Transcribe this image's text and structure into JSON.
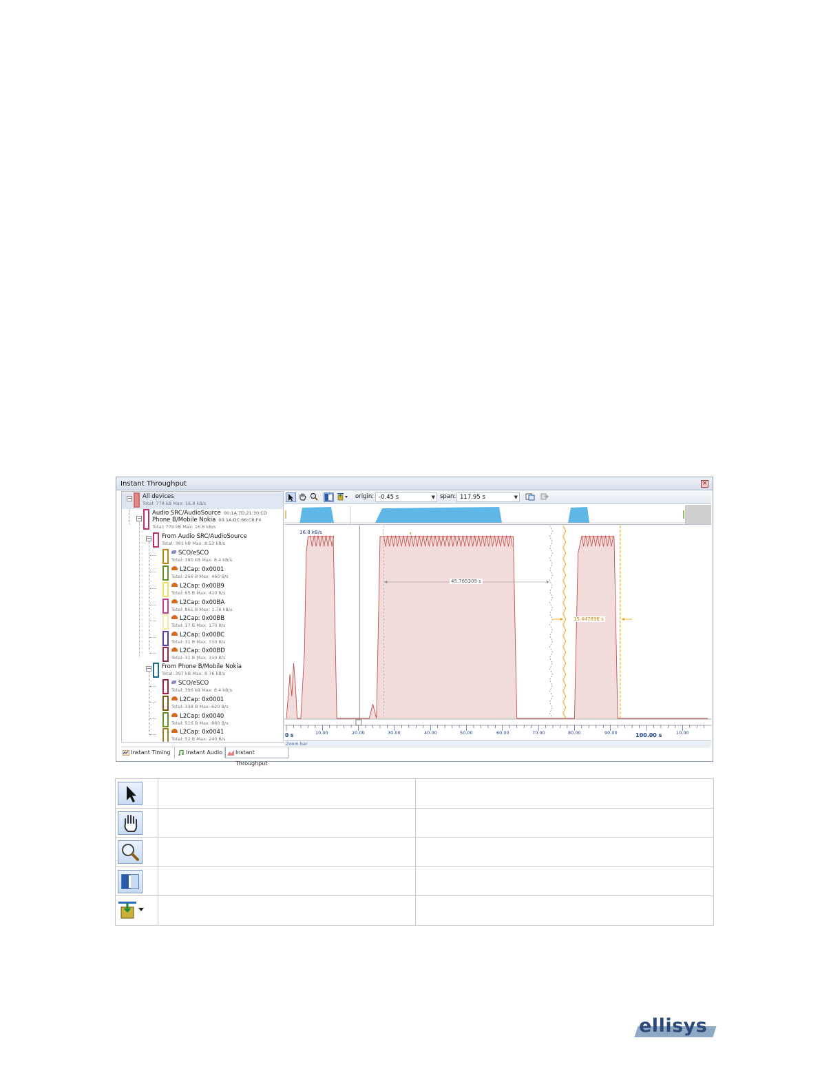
{
  "window": {
    "title": "Instant Throughput",
    "close_symbol": "×"
  },
  "tree": {
    "all_devices": {
      "name": "All devices",
      "stats": "Total: 778 kB Max: 16.8 kB/s",
      "color": "#e08888"
    },
    "devices": [
      {
        "name": "Audio SRC/AudioSource",
        "address": "00:1A:7D:21:30:CD"
      },
      {
        "name": "Phone B/Mobile Nokia",
        "address": "00:1A:DC:66:C8:F4",
        "stats": "Total: 778 kB Max: 16.8 kB/s"
      }
    ],
    "from_audio": {
      "name": "From Audio SRC/AudioSource",
      "stats": "Total: 381 kB Max: 8.53 kB/s"
    },
    "from_audio_channels": [
      {
        "name": "SCO/eSCO",
        "stats": "Total: 380 kB Max: 8.4 kB/s",
        "color": "#b8860b"
      },
      {
        "name": "L2Cap: 0x0001",
        "stats": "Total: 266 B Max: 460 B/s",
        "color": "#6b8e23"
      },
      {
        "name": "L2Cap: 0x00B9",
        "stats": "Total: 65 B Max: 410 B/s",
        "color": "#f0e060"
      },
      {
        "name": "L2Cap: 0x00BA",
        "stats": "Total: 861 B Max: 1.76 kB/s",
        "color": "#d04090"
      },
      {
        "name": "L2Cap: 0x00BB",
        "stats": "Total: 17 B Max: 170 B/s",
        "color": "#f5e8a0"
      },
      {
        "name": "L2Cap: 0x00BC",
        "stats": "Total: 31 B Max: 310 B/s",
        "color": "#5a3a9a"
      },
      {
        "name": "L2Cap: 0x00BD",
        "stats": "Total: 31 B Max: 310 B/s",
        "color": "#9a2a4a"
      }
    ],
    "from_phone": {
      "name": "From Phone B/Mobile Nokia",
      "stats": "Total: 397 kB Max: 8.76 kB/s"
    },
    "from_phone_channels": [
      {
        "name": "SCO/eSCO",
        "stats": "Total: 396 kB Max: 8.4 kB/s",
        "color": "#a02040"
      },
      {
        "name": "L2Cap: 0x0001",
        "stats": "Total: 338 B Max: 620 B/s",
        "color": "#7a5a10"
      },
      {
        "name": "L2Cap: 0x0040",
        "stats": "Total: 516 B Max: 860 B/s",
        "color": "#6b8e23"
      },
      {
        "name": "L2Cap: 0x0041",
        "stats": "Total: 52 B Max: 240 B/s",
        "color": "#a08020"
      }
    ]
  },
  "toolbar": {
    "origin_label": "origin:",
    "origin_value": "-0.45 s",
    "span_label": "span:",
    "span_value": "117.95 s"
  },
  "chart": {
    "peak_label": "16.8 kB/s",
    "measure_1": "45.765309 s",
    "measure_2": "15.447696 s",
    "x_origin": "0 s",
    "x_big": "100.00 s",
    "zoom_bar_label": "Zoom bar",
    "series_color": "#c0504d",
    "fill_color": "#f2dcdb",
    "overview_color": "#5fb7e8",
    "cursor_color": "#e8a000"
  },
  "chart_data": {
    "type": "area",
    "ylabel": "",
    "xlabel": "",
    "x_tick_labels": [
      "10.00",
      "20.00",
      "30.00",
      "40.00",
      "50.00",
      "60.00",
      "70.00",
      "80.00",
      "90.00",
      "100.00",
      "10.00"
    ],
    "series": [
      {
        "x": [
          0,
          1,
          1.5,
          2,
          2.5,
          3,
          4,
          5,
          5.5,
          6,
          7,
          12,
          13,
          14,
          20,
          23,
          24,
          25,
          25.5,
          26,
          27,
          62,
          63,
          64,
          70,
          80,
          81,
          82,
          90,
          91,
          92,
          100,
          117
        ],
        "y": [
          0,
          4,
          2,
          5,
          3,
          0,
          0,
          6,
          15,
          16.5,
          16.5,
          16.5,
          16.5,
          0,
          0,
          0,
          1.3,
          0,
          8,
          16.5,
          16.5,
          16.5,
          16.5,
          0,
          0,
          0,
          15,
          16.5,
          16.5,
          16.5,
          0,
          0,
          0
        ]
      }
    ],
    "annotations": [
      "16.8 kB/s",
      "45.765309 s",
      "15.447696 s"
    ]
  },
  "tabs": [
    {
      "label": "Instant Timing"
    },
    {
      "label": "Instant Audio"
    },
    {
      "label": "Instant Throughput"
    }
  ],
  "legend_rows": [
    {
      "icon": "pointer-icon"
    },
    {
      "icon": "hand-icon"
    },
    {
      "icon": "zoom-icon"
    },
    {
      "icon": "panes-icon"
    },
    {
      "icon": "marker-icon"
    }
  ],
  "logo": {
    "text": "ellisys"
  }
}
